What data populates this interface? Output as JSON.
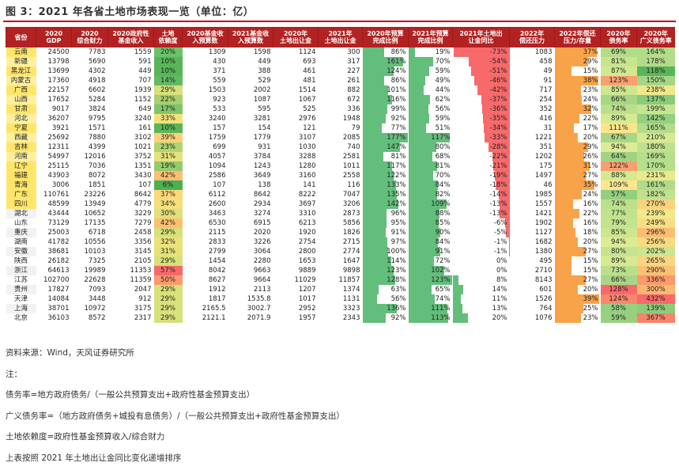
{
  "title": "图 3：2021 年各省土地市场表现一览（单位：亿）",
  "headers": [
    [
      "省份"
    ],
    [
      "2020",
      "GDP"
    ],
    [
      "2020",
      "综合财力"
    ],
    [
      "2020政府性",
      "基金收入"
    ],
    [
      "土地",
      "依赖度"
    ],
    [
      "2020基金收",
      "入预算数"
    ],
    [
      "2021基金收",
      "入预算数"
    ],
    [
      "2020年",
      "土地出让金"
    ],
    [
      "2021年",
      "土地出让金"
    ],
    [
      "2020年预算",
      "完成比例"
    ],
    [
      "2021年预算",
      "完成比例"
    ],
    [
      "2021年土地出",
      "让金同比"
    ],
    [
      "2022年",
      "偿还压力"
    ],
    [
      "2022年偿还",
      "压力/存量"
    ],
    [
      "2020年",
      "债务率"
    ],
    [
      "2020年",
      "广义债务率"
    ]
  ],
  "rows": [
    {
      "province": "云南",
      "gdp": "24500",
      "fin": "7783",
      "fund": "1559",
      "dep": "20%",
      "b20": "1309",
      "b21": "1598",
      "l20": "1124",
      "l21": "300",
      "c20": "86%",
      "c21": "19%",
      "yoy": "-73%",
      "repay": "1083",
      "rs": "37%",
      "debt": "69%",
      "bdebt": "164%",
      "dep_v": 20,
      "c20_v": 86,
      "c21_v": 19,
      "yoy_v": -73,
      "rs_v": 37,
      "debt_v": 69,
      "bdebt_v": 164,
      "dep_color": "#6cc26c",
      "debt_color": "#b3dc8a",
      "bdebt_color": "#b3dc8a"
    },
    {
      "province": "新疆",
      "gdp": "13798",
      "fin": "5690",
      "fund": "591",
      "dep": "10%",
      "b20": "430",
      "b21": "449",
      "l20": "693",
      "l21": "317",
      "c20": "161%",
      "c21": "70%",
      "yoy": "-54%",
      "repay": "458",
      "rs": "29%",
      "debt": "81%",
      "bdebt": "178%",
      "dep_v": 10,
      "c20_v": 161,
      "c21_v": 70,
      "yoy_v": -54,
      "rs_v": 29,
      "debt_v": 81,
      "bdebt_v": 178,
      "dep_color": "#5ab55a",
      "debt_color": "#c7e48f",
      "bdebt_color": "#b3dc8a"
    },
    {
      "province": "黑龙江",
      "gdp": "13699",
      "fin": "4302",
      "fund": "449",
      "dep": "10%",
      "b20": "371",
      "b21": "388",
      "l20": "461",
      "l21": "227",
      "c20": "124%",
      "c21": "59%",
      "yoy": "-51%",
      "repay": "49",
      "rs": "15%",
      "debt": "87%",
      "bdebt": "118%",
      "dep_v": 10,
      "c20_v": 124,
      "c21_v": 59,
      "yoy_v": -51,
      "rs_v": 15,
      "debt_v": 87,
      "bdebt_v": 118,
      "dep_color": "#5ab55a",
      "debt_color": "#d2e891",
      "bdebt_color": "#5ab55a"
    },
    {
      "province": "内蒙古",
      "gdp": "17360",
      "fin": "4918",
      "fund": "707",
      "dep": "14%",
      "b20": "559",
      "b21": "529",
      "l20": "481",
      "l21": "261",
      "c20": "86%",
      "c21": "49%",
      "yoy": "-46%",
      "repay": "91",
      "rs": "38%",
      "debt": "123%",
      "bdebt": "150%",
      "dep_v": 14,
      "c20_v": 86,
      "c21_v": 49,
      "yoy_v": -46,
      "rs_v": 38,
      "debt_v": 123,
      "bdebt_v": 150,
      "dep_color": "#62ba62",
      "debt_color": "#f8a070",
      "bdebt_color": "#a5d685"
    },
    {
      "province": "广西",
      "gdp": "22157",
      "fin": "6602",
      "fund": "1939",
      "dep": "29%",
      "b20": "1503",
      "b21": "2002",
      "l20": "1514",
      "l21": "882",
      "c20": "101%",
      "c21": "44%",
      "yoy": "-42%",
      "repay": "717",
      "rs": "23%",
      "debt": "85%",
      "bdebt": "238%",
      "dep_v": 29,
      "c20_v": 101,
      "c21_v": 44,
      "yoy_v": -42,
      "rs_v": 23,
      "debt_v": 85,
      "bdebt_v": 238,
      "dep_color": "#d8e07a",
      "debt_color": "#cde690",
      "bdebt_color": "#f0e88a"
    },
    {
      "province": "山西",
      "gdp": "17652",
      "fin": "5284",
      "fund": "1152",
      "dep": "22%",
      "b20": "923",
      "b21": "1087",
      "l20": "1067",
      "l21": "672",
      "c20": "116%",
      "c21": "62%",
      "yoy": "-37%",
      "repay": "254",
      "rs": "24%",
      "debt": "66%",
      "bdebt": "137%",
      "dep_v": 22,
      "c20_v": 116,
      "c21_v": 62,
      "yoy_v": -37,
      "rs_v": 24,
      "debt_v": 66,
      "bdebt_v": 137,
      "dep_color": "#a8d06e",
      "debt_color": "#a8d685",
      "bdebt_color": "#8acb7a"
    },
    {
      "province": "甘肃",
      "gdp": "9017",
      "fin": "3824",
      "fund": "649",
      "dep": "17%",
      "b20": "533",
      "b21": "595",
      "l20": "525",
      "l21": "336",
      "c20": "99%",
      "c21": "56%",
      "yoy": "-36%",
      "repay": "352",
      "rs": "32%",
      "debt": "74%",
      "bdebt": "199%",
      "dep_v": 17,
      "c20_v": 99,
      "c21_v": 56,
      "yoy_v": -36,
      "rs_v": 32,
      "debt_v": 74,
      "bdebt_v": 199,
      "dep_color": "#82c46a",
      "debt_color": "#bbe08c",
      "bdebt_color": "#c7e48f"
    },
    {
      "province": "河北",
      "gdp": "36207",
      "fin": "9795",
      "fund": "3240",
      "dep": "33%",
      "b20": "3240",
      "b21": "3281",
      "l20": "2976",
      "l21": "1948",
      "c20": "92%",
      "c21": "59%",
      "yoy": "-35%",
      "repay": "416",
      "rs": "22%",
      "debt": "89%",
      "bdebt": "142%",
      "dep_v": 33,
      "c20_v": 92,
      "c21_v": 59,
      "yoy_v": -35,
      "rs_v": 22,
      "debt_v": 89,
      "bdebt_v": 142,
      "dep_color": "#f1e37a",
      "debt_color": "#d7ea92",
      "bdebt_color": "#95cf7f"
    },
    {
      "province": "宁夏",
      "gdp": "3921",
      "fin": "1571",
      "fund": "161",
      "dep": "10%",
      "b20": "157",
      "b21": "154",
      "l20": "121",
      "l21": "79",
      "c20": "77%",
      "c21": "51%",
      "yoy": "-34%",
      "repay": "31",
      "rs": "17%",
      "debt": "111%",
      "bdebt": "165%",
      "dep_v": 10,
      "c20_v": 77,
      "c21_v": 51,
      "yoy_v": -34,
      "rs_v": 17,
      "debt_v": 111,
      "bdebt_v": 165,
      "dep_color": "#5ab55a",
      "debt_color": "#fde48a",
      "bdebt_color": "#b3dc8a"
    },
    {
      "province": "西藏",
      "gdp": "25692",
      "fin": "7880",
      "fund": "3102",
      "dep": "39%",
      "b20": "1759",
      "b21": "1779",
      "l20": "3107",
      "l21": "2085",
      "c20": "177%",
      "c21": "117%",
      "yoy": "-33%",
      "repay": "1221",
      "rs": "20%",
      "debt": "67%",
      "bdebt": "210%",
      "dep_v": 39,
      "c20_v": 177,
      "c21_v": 117,
      "yoy_v": -33,
      "rs_v": 20,
      "debt_v": 67,
      "bdebt_v": 210,
      "dep_color": "#fdd07a",
      "debt_color": "#aad685",
      "bdebt_color": "#d7ea92"
    },
    {
      "province": "吉林",
      "gdp": "12311",
      "fin": "4399",
      "fund": "1021",
      "dep": "23%",
      "b20": "699",
      "b21": "931",
      "l20": "1030",
      "l21": "740",
      "c20": "147%",
      "c21": "80%",
      "yoy": "-28%",
      "repay": "351",
      "rs": "29%",
      "debt": "94%",
      "bdebt": "180%",
      "dep_v": 23,
      "c20_v": 147,
      "c21_v": 80,
      "yoy_v": -28,
      "rs_v": 29,
      "debt_v": 94,
      "bdebt_v": 180,
      "dep_color": "#afd370",
      "debt_color": "#ddec94",
      "bdebt_color": "#bfe18d"
    },
    {
      "province": "河南",
      "gdp": "54997",
      "fin": "12016",
      "fund": "3752",
      "dep": "31%",
      "b20": "4057",
      "b21": "3784",
      "l20": "3288",
      "l21": "2581",
      "c20": "81%",
      "c21": "68%",
      "yoy": "-22%",
      "repay": "1202",
      "rs": "26%",
      "debt": "64%",
      "bdebt": "169%",
      "dep_v": 31,
      "c20_v": 81,
      "c21_v": 68,
      "yoy_v": -22,
      "rs_v": 26,
      "debt_v": 64,
      "bdebt_v": 169,
      "dep_color": "#e6e27a",
      "debt_color": "#a2d383",
      "bdebt_color": "#b7de8b"
    },
    {
      "province": "辽宁",
      "gdp": "25115",
      "fin": "7036",
      "fund": "1351",
      "dep": "19%",
      "b20": "1094",
      "b21": "1243",
      "l20": "1280",
      "l21": "1011",
      "c20": "117%",
      "c21": "81%",
      "yoy": "-21%",
      "repay": "175",
      "rs": "31%",
      "debt": "122%",
      "bdebt": "170%",
      "dep_v": 19,
      "c20_v": 117,
      "c21_v": 81,
      "yoy_v": -21,
      "rs_v": 31,
      "debt_v": 122,
      "bdebt_v": 170,
      "dep_color": "#95cb6c",
      "debt_color": "#f8a070",
      "bdebt_color": "#b7de8b"
    },
    {
      "province": "福建",
      "gdp": "43903",
      "fin": "8072",
      "fund": "3430",
      "dep": "42%",
      "b20": "2586",
      "b21": "3649",
      "l20": "3160",
      "l21": "2558",
      "c20": "122%",
      "c21": "70%",
      "yoy": "-19%",
      "repay": "1497",
      "rs": "27%",
      "debt": "88%",
      "bdebt": "231%",
      "dep_v": 42,
      "c20_v": 122,
      "c21_v": 70,
      "yoy_v": -19,
      "rs_v": 27,
      "debt_v": 88,
      "bdebt_v": 231,
      "dep_color": "#fcbf72",
      "debt_color": "#d5e991",
      "bdebt_color": "#ebe98a"
    },
    {
      "province": "青海",
      "gdp": "3006",
      "fin": "1851",
      "fund": "107",
      "dep": "6%",
      "b20": "107",
      "b21": "138",
      "l20": "141",
      "l21": "116",
      "c20": "133%",
      "c21": "84%",
      "yoy": "-18%",
      "repay": "46",
      "rs": "35%",
      "debt": "109%",
      "bdebt": "161%",
      "dep_v": 6,
      "c20_v": 133,
      "c21_v": 84,
      "yoy_v": -18,
      "rs_v": 35,
      "debt_v": 109,
      "bdebt_v": 161,
      "dep_color": "#4caf50",
      "debt_color": "#fde68c",
      "bdebt_color": "#b0db89"
    },
    {
      "province": "广东",
      "gdp": "110761",
      "fin": "23226",
      "fund": "8642",
      "dep": "37%",
      "b20": "6112",
      "b21": "8642",
      "l20": "8222",
      "l21": "7047",
      "c20": "135%",
      "c21": "82%",
      "yoy": "-14%",
      "repay": "1985",
      "rs": "24%",
      "debt": "57%",
      "bdebt": "182%",
      "dep_v": 37,
      "c20_v": 135,
      "c21_v": 82,
      "yoy_v": -14,
      "rs_v": 24,
      "debt_v": 57,
      "bdebt_v": 182,
      "dep_color": "#fcd87a",
      "debt_color": "#94cf7f",
      "bdebt_color": "#c1e18d"
    },
    {
      "province": "四川",
      "gdp": "48599",
      "fin": "13949",
      "fund": "4779",
      "dep": "34%",
      "b20": "2600",
      "b21": "2934",
      "l20": "3697",
      "l21": "3206",
      "c20": "142%",
      "c21": "109%",
      "yoy": "-13%",
      "repay": "1557",
      "rs": "16%",
      "debt": "74%",
      "bdebt": "270%",
      "dep_v": 34,
      "c20_v": 142,
      "c21_v": 109,
      "yoy_v": -13,
      "rs_v": 16,
      "debt_v": 74,
      "bdebt_v": 270,
      "dep_color": "#f5e07a",
      "debt_color": "#bbe08c",
      "bdebt_color": "#fbd27c"
    },
    {
      "province": "湖北",
      "gdp": "43444",
      "fin": "10652",
      "fund": "3229",
      "dep": "30%",
      "b20": "3463",
      "b21": "3274",
      "l20": "3310",
      "l21": "2873",
      "c20": "96%",
      "c21": "88%",
      "yoy": "-13%",
      "repay": "1421",
      "rs": "22%",
      "debt": "77%",
      "bdebt": "239%",
      "dep_v": 30,
      "c20_v": 96,
      "c21_v": 88,
      "yoy_v": -13,
      "rs_v": 22,
      "debt_v": 77,
      "bdebt_v": 239,
      "dep_color": "#e0e07a",
      "debt_color": "#c1e28e",
      "bdebt_color": "#f2e88a"
    },
    {
      "province": "山东",
      "gdp": "73129",
      "fin": "17135",
      "fund": "7279",
      "dep": "42%",
      "b20": "6530",
      "b21": "6915",
      "l20": "6213",
      "l21": "5856",
      "c20": "95%",
      "c21": "85%",
      "yoy": "-6%",
      "repay": "1902",
      "rs": "16%",
      "debt": "79%",
      "bdebt": "249%",
      "dep_v": 42,
      "c20_v": 95,
      "c21_v": 85,
      "yoy_v": -6,
      "rs_v": 16,
      "debt_v": 79,
      "bdebt_v": 249,
      "dep_color": "#fcbf72",
      "debt_color": "#c4e38e",
      "bdebt_color": "#f7de84"
    },
    {
      "province": "重庆",
      "gdp": "25003",
      "fin": "6718",
      "fund": "2458",
      "dep": "29%",
      "b20": "2115",
      "b21": "2020",
      "l20": "1920",
      "l21": "1826",
      "c20": "91%",
      "c21": "90%",
      "yoy": "-5%",
      "repay": "1127",
      "rs": "18%",
      "debt": "85%",
      "bdebt": "296%",
      "dep_v": 29,
      "c20_v": 91,
      "c21_v": 90,
      "yoy_v": -5,
      "rs_v": 18,
      "debt_v": 85,
      "bdebt_v": 296,
      "dep_color": "#d8e07a",
      "debt_color": "#cde690",
      "bdebt_color": "#fcbc72"
    },
    {
      "province": "湖南",
      "gdp": "41782",
      "fin": "10556",
      "fund": "3356",
      "dep": "32%",
      "b20": "2833",
      "b21": "3226",
      "l20": "2754",
      "l21": "2715",
      "c20": "97%",
      "c21": "84%",
      "yoy": "-1%",
      "repay": "1682",
      "rs": "20%",
      "debt": "94%",
      "bdebt": "256%",
      "dep_v": 32,
      "c20_v": 97,
      "c21_v": 84,
      "yoy_v": -1,
      "rs_v": 20,
      "debt_v": 94,
      "bdebt_v": 256,
      "dep_color": "#ebe27a",
      "debt_color": "#ddec94",
      "bdebt_color": "#f8da80"
    },
    {
      "province": "安徽",
      "gdp": "38681",
      "fin": "10103",
      "fund": "3145",
      "dep": "31%",
      "b20": "2799",
      "b21": "3064",
      "l20": "2800",
      "l21": "2774",
      "c20": "100%",
      "c21": "91%",
      "yoy": "-1%",
      "repay": "1380",
      "rs": "27%",
      "debt": "80%",
      "bdebt": "202%",
      "dep_v": 31,
      "c20_v": 100,
      "c21_v": 91,
      "yoy_v": -1,
      "rs_v": 27,
      "debt_v": 80,
      "bdebt_v": 202,
      "dep_color": "#e6e27a",
      "debt_color": "#c6e48f",
      "bdebt_color": "#cbe68f"
    },
    {
      "province": "陕西",
      "gdp": "26182",
      "fin": "7325",
      "fund": "2105",
      "dep": "29%",
      "b20": "1454",
      "b21": "2280",
      "l20": "1653",
      "l21": "1647",
      "c20": "114%",
      "c21": "72%",
      "yoy": "0%",
      "repay": "495",
      "rs": "15%",
      "debt": "89%",
      "bdebt": "265%",
      "dep_v": 29,
      "c20_v": 114,
      "c21_v": 72,
      "yoy_v": 0,
      "rs_v": 15,
      "debt_v": 89,
      "bdebt_v": 265,
      "dep_color": "#d8e07a",
      "debt_color": "#d7ea92",
      "bdebt_color": "#fad57e"
    },
    {
      "province": "浙江",
      "gdp": "64613",
      "fin": "19989",
      "fund": "11353",
      "dep": "57%",
      "b20": "8042",
      "b21": "9663",
      "l20": "9889",
      "l21": "9898",
      "c20": "123%",
      "c21": "102%",
      "yoy": "0%",
      "repay": "2710",
      "rs": "15%",
      "debt": "73%",
      "bdebt": "290%",
      "dep_v": 57,
      "c20_v": 123,
      "c21_v": 102,
      "yoy_v": 0,
      "rs_v": 15,
      "debt_v": 73,
      "bdebt_v": 290,
      "dep_color": "#f8696b",
      "debt_color": "#b9df8b",
      "bdebt_color": "#fcc074"
    },
    {
      "province": "江苏",
      "gdp": "102700",
      "fin": "22628",
      "fund": "11359",
      "dep": "50%",
      "b20": "8627",
      "b21": "9664",
      "l20": "11029",
      "l21": "11857",
      "c20": "128%",
      "c21": "123%",
      "yoy": "8%",
      "repay": "8143",
      "rs": "27%",
      "debt": "66%",
      "bdebt": "336%",
      "dep_v": 50,
      "c20_v": 128,
      "c21_v": 123,
      "yoy_v": 8,
      "rs_v": 27,
      "debt_v": 66,
      "bdebt_v": 336,
      "dep_color": "#fa9a6e",
      "debt_color": "#a8d685",
      "bdebt_color": "#f99a6c"
    },
    {
      "province": "贵州",
      "gdp": "17827",
      "fin": "7093",
      "fund": "2047",
      "dep": "29%",
      "b20": "1912",
      "b21": "2113",
      "l20": "1207",
      "l21": "1374",
      "c20": "63%",
      "c21": "65%",
      "yoy": "14%",
      "repay": "601",
      "rs": "20%",
      "debt": "128%",
      "bdebt": "300%",
      "dep_v": 29,
      "c20_v": 63,
      "c21_v": 65,
      "yoy_v": 14,
      "rs_v": 20,
      "debt_v": 128,
      "bdebt_v": 300,
      "dep_color": "#d8e07a",
      "debt_color": "#f8696b",
      "bdebt_color": "#fcb870"
    },
    {
      "province": "天津",
      "gdp": "14084",
      "fin": "3448",
      "fund": "912",
      "dep": "29%",
      "b20": "1817",
      "b21": "1535.8",
      "l20": "1017",
      "l21": "1131",
      "c20": "56%",
      "c21": "74%",
      "yoy": "11%",
      "repay": "1526",
      "rs": "39%",
      "debt": "124%",
      "bdebt": "432%",
      "dep_v": 29,
      "c20_v": 56,
      "c21_v": 74,
      "yoy_v": 11,
      "rs_v": 39,
      "debt_v": 124,
      "bdebt_v": 432,
      "dep_color": "#d8e07a",
      "debt_color": "#f8886c",
      "bdebt_color": "#f8696b"
    },
    {
      "province": "上海",
      "gdp": "38701",
      "fin": "10972",
      "fund": "3175",
      "dep": "29%",
      "b20": "2165.5",
      "b21": "3002.7",
      "l20": "2952",
      "l21": "3323",
      "c20": "136%",
      "c21": "111%",
      "yoy": "13%",
      "repay": "764",
      "rs": "25%",
      "debt": "58%",
      "bdebt": "139%",
      "dep_v": 29,
      "c20_v": 136,
      "c21_v": 111,
      "yoy_v": 13,
      "rs_v": 25,
      "debt_v": 58,
      "bdebt_v": 139,
      "dep_color": "#d8e07a",
      "debt_color": "#96d080",
      "bdebt_color": "#8ecc7b"
    },
    {
      "province": "北京",
      "gdp": "36103",
      "fin": "8572",
      "fund": "2317",
      "dep": "29%",
      "b20": "2121.1",
      "b21": "2071.9",
      "l20": "1957",
      "l21": "2343",
      "c20": "92%",
      "c21": "113%",
      "yoy": "20%",
      "repay": "1076",
      "rs": "23%",
      "debt": "59%",
      "bdebt": "367%",
      "dep_v": 29,
      "c20_v": 92,
      "c21_v": 113,
      "yoy_v": 20,
      "rs_v": 23,
      "debt_v": 59,
      "bdebt_v": 367,
      "dep_color": "#d8e07a",
      "debt_color": "#98d080",
      "bdebt_color": "#f8836c"
    }
  ],
  "notes": [
    "资料来源：Wind，天风证券研究所",
    "注：",
    "债务率=地方政府债务/（一般公共预算支出+政府性基金预算支出）",
    "广义债务率=（地方政府债务+城投有息债务）/（一般公共预算支出+政府性基金预算支出）",
    "土地依赖度=政府性基金预算收入/综合财力",
    "上表按照 2021 年土地出让金同比变化递增排序"
  ],
  "colors": {
    "header_bg": "#b22222",
    "title_rule": "#c00000",
    "province_bg": "#ffe66b",
    "completion_bar": "#63be7b",
    "yoy_negative_bar": "#f8696b",
    "yoy_positive_bar": "#63be7b",
    "pressure_bar": "#f8a34a"
  }
}
